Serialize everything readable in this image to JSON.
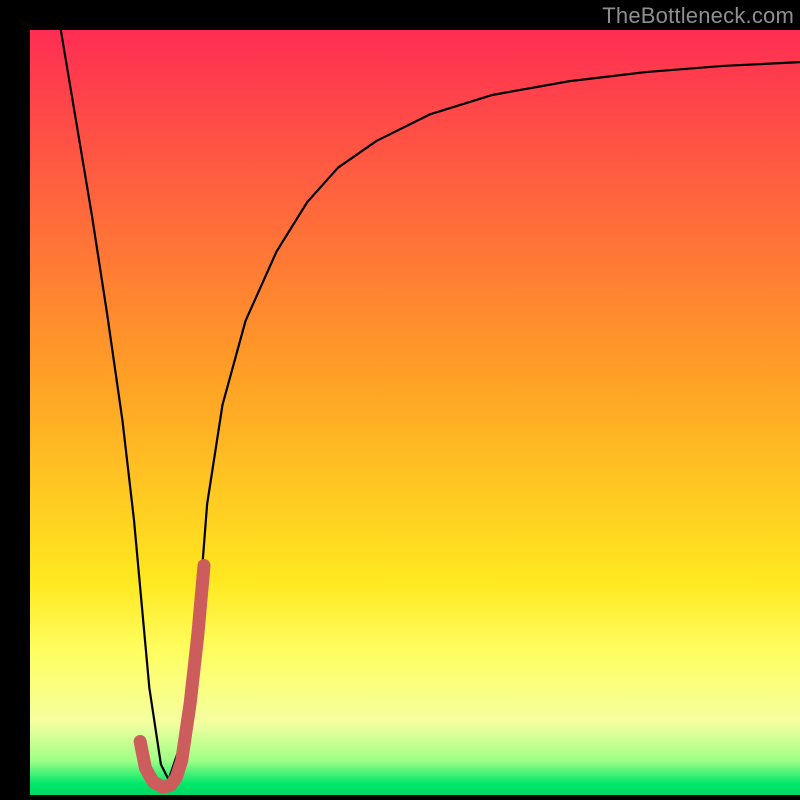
{
  "watermark": "TheBottleneck.com",
  "chart_data": {
    "type": "line",
    "title": "",
    "xlabel": "",
    "ylabel": "",
    "xlim": [
      0,
      100
    ],
    "ylim": [
      0,
      100
    ],
    "grid": false,
    "legend": false,
    "gradient_stops": [
      {
        "offset": 0.0,
        "color": "#ff2d53"
      },
      {
        "offset": 0.45,
        "color": "#ff9f26"
      },
      {
        "offset": 0.72,
        "color": "#ffe81f"
      },
      {
        "offset": 0.82,
        "color": "#ffff66"
      },
      {
        "offset": 0.905,
        "color": "#f4ffa0"
      },
      {
        "offset": 0.955,
        "color": "#9fff86"
      },
      {
        "offset": 0.985,
        "color": "#00e86a"
      },
      {
        "offset": 1.0,
        "color": "#00d864"
      }
    ],
    "series": [
      {
        "name": "bottleneck-curve",
        "stroke": "#000000",
        "stroke_width": 2.2,
        "x": [
          4.0,
          6.0,
          8.0,
          10.0,
          12.0,
          13.5,
          14.5,
          15.5,
          17.0,
          18.0,
          20.0,
          22.0,
          23.0,
          25.0,
          28.0,
          32.0,
          36.0,
          40.0,
          45.0,
          52.0,
          60.0,
          70.0,
          80.0,
          90.0,
          100.0
        ],
        "values": [
          100,
          88,
          76,
          63,
          49,
          36,
          25,
          14,
          4,
          2,
          8,
          25,
          38,
          51,
          62,
          71,
          77.5,
          82,
          85.5,
          89,
          91.5,
          93.3,
          94.5,
          95.3,
          95.8
        ]
      },
      {
        "name": "highlight-j",
        "stroke": "#cd5c5c",
        "stroke_width": 13,
        "linecap": "round",
        "x": [
          14.3,
          15.0,
          16.0,
          17.3,
          18.3,
          19.0,
          19.7,
          20.8,
          21.8,
          22.6
        ],
        "values": [
          7.0,
          3.5,
          1.7,
          1.0,
          1.3,
          2.3,
          4.5,
          12.0,
          21.0,
          30.0
        ]
      }
    ]
  }
}
